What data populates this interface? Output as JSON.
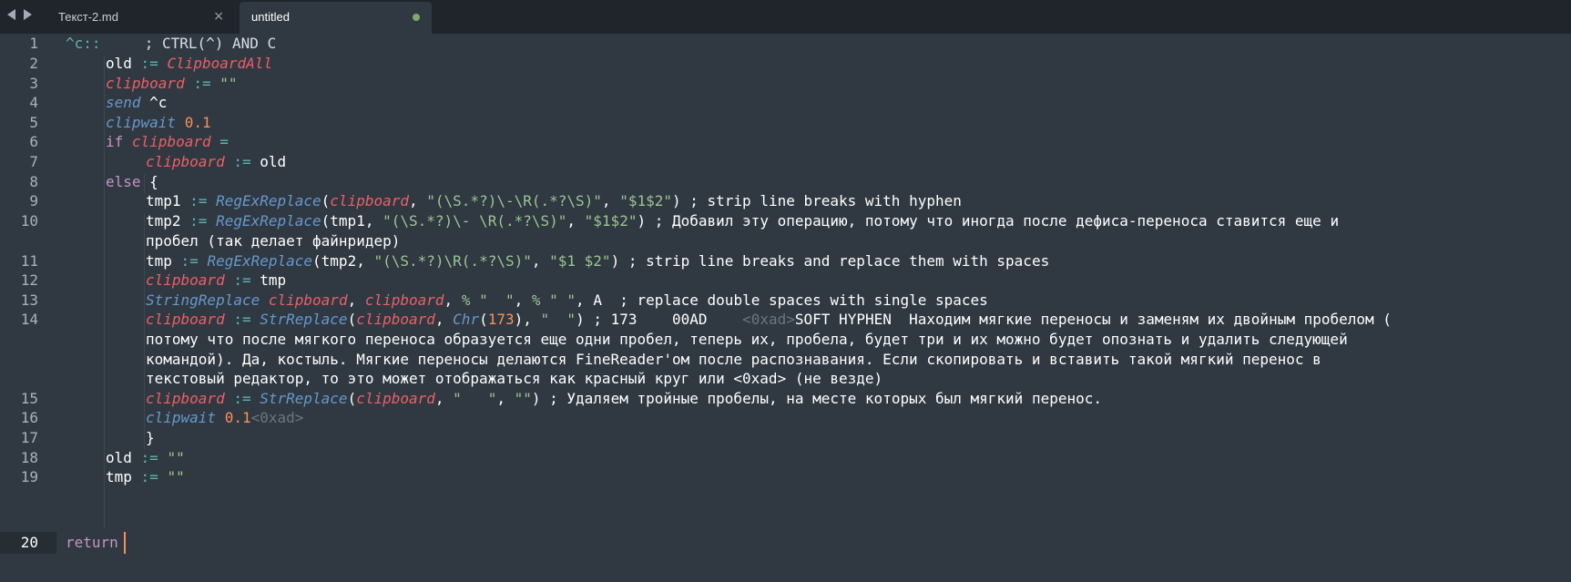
{
  "tabs": [
    {
      "label": "Текст-2.md",
      "active": false
    },
    {
      "label": "untitled",
      "active": true
    }
  ],
  "tab_close_glyph": "×",
  "line_numbers": [
    "1",
    "2",
    "3",
    "4",
    "5",
    "6",
    "7",
    "8",
    "9",
    "10",
    "11",
    "12",
    "13",
    "14",
    "15",
    "16",
    "17",
    "18",
    "19",
    "20"
  ],
  "current_line": "20",
  "code": {
    "l1": {
      "a": "^c::",
      "b": "     ; CTRL(^) AND C"
    },
    "l2": {
      "a": "old",
      "b": " := ",
      "c": "ClipboardAll"
    },
    "l3": {
      "a": "clipboard",
      "b": " := ",
      "c": "\"\""
    },
    "l4": {
      "a": "send",
      "b": " ^c"
    },
    "l5": {
      "a": "clipwait",
      "b": " ",
      "c": "0.1"
    },
    "l6": {
      "a": "if",
      "b": " ",
      "c": "clipboard",
      "d": " ="
    },
    "l7": {
      "a": "clipboard",
      "b": " := ",
      "c": "old"
    },
    "l8": {
      "a": "else",
      "b": " {"
    },
    "l9": {
      "a": "tmp1",
      "b": " := ",
      "c": "RegExReplace",
      "d": "(",
      "e": "clipboard",
      "f": ", ",
      "g": "\"(\\S.*?)\\-\\R(.*?\\S)\"",
      "h": ", ",
      "i": "\"$1$2\"",
      "j": ") ; strip line breaks with hyphen"
    },
    "l10": {
      "a": "tmp2",
      "b": " := ",
      "c": "RegExReplace",
      "d": "(tmp1, ",
      "e": "\"(\\S.*?)\\- \\R(.*?\\S)\"",
      "f": ", ",
      "g": "\"$1$2\"",
      "h": ") ; Добавил эту операцию, потому что иногда после дефиса-переноса ставится еще и",
      "i": "пробел (так делает файнридер)"
    },
    "l11": {
      "a": "tmp",
      "b": " := ",
      "c": "RegExReplace",
      "d": "(tmp2, ",
      "e": "\"(\\S.*?)\\R(.*?\\S)\"",
      "f": ", ",
      "g": "\"$1 $2\"",
      "h": ") ; strip line breaks and replace them with spaces"
    },
    "l12": {
      "a": "clipboard",
      "b": " := ",
      "c": "tmp"
    },
    "l13": {
      "a": "StringReplace",
      "b": " ",
      "c": "clipboard",
      "d": ", ",
      "e": "clipboard",
      "f": ", ",
      "g": "% \"  \"",
      "h": ", ",
      "i": "% \" \"",
      "j": ", A  ; replace double spaces with single spaces"
    },
    "l14": {
      "a": "clipboard",
      "b": " := ",
      "c": "StrReplace",
      "d": "(",
      "e": "clipboard",
      "f": ", ",
      "g": "Chr",
      "h": "(",
      "i": "173",
      "j": "), ",
      "k": "\"  \"",
      "l": ") ; 173    00AD    ",
      "m": "<0xad>",
      "n": "SOFT HYPHEN  Находим мягкие переносы и заменям их двойным пробелом (",
      "o": "потому что после мягкого переноса образуется еще одни пробел, теперь их, пробела, будет три и их можно будет опознать и удалить следующей",
      "p": "командой). Да, костыль. Мягкие переносы делаются FineReader'ом после распознавания. Если скопировать и вставить такой мягкий перенос в",
      "q": "текстовый редактор, то это может отображаться как красный круг или <0xad> (не везде)"
    },
    "l15": {
      "a": "clipboard",
      "b": " := ",
      "c": "StrReplace",
      "d": "(",
      "e": "clipboard",
      "f": ", ",
      "g": "\"   \"",
      "h": ", ",
      "i": "\"\"",
      "j": ") ; Удаляем тройные пробелы, на месте которых был мягкий перенос."
    },
    "l16": {
      "a": "clipwait",
      "b": " ",
      "c": "0.1",
      "d": "<0xad>"
    },
    "l17": {
      "a": "}"
    },
    "l18": {
      "a": "old",
      "b": " := ",
      "c": "\"\""
    },
    "l19": {
      "a": "tmp",
      "b": " := ",
      "c": "\"\""
    },
    "l20": {
      "a": "return"
    }
  },
  "colors": {
    "background": "#303841",
    "tabbar": "#1f252b",
    "keyword": "#c594c5",
    "command": "#6699cc",
    "variable": "#ec5f66",
    "string": "#99c794",
    "number": "#f99157",
    "operator": "#5fb4b4",
    "dirty_dot": "#7da870"
  }
}
